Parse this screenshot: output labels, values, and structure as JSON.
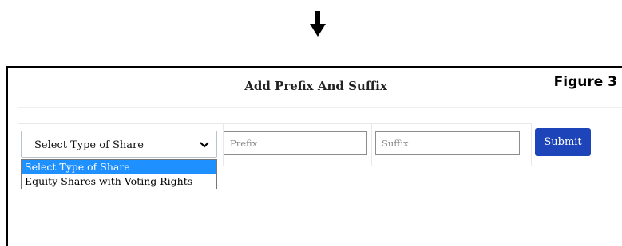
{
  "form": {
    "title": "Add Prefix And Suffix",
    "figure_label": "Figure 3",
    "share_select": {
      "selected": "Select Type of Share",
      "options": [
        "Select Type of Share",
        "Equity Shares with Voting Rights"
      ]
    },
    "prefix": {
      "placeholder": "Prefix",
      "value": ""
    },
    "suffix": {
      "placeholder": "Suffix",
      "value": ""
    },
    "submit_label": "Submit"
  },
  "colors": {
    "accent": "#1d44b8",
    "option_highlight": "#1e90ff"
  },
  "icons": [
    "down-arrow-icon",
    "chevron-down-icon"
  ]
}
